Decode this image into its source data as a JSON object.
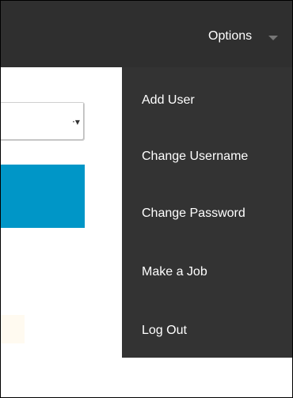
{
  "header": {
    "options_label": "Options",
    "options_caret_icon": "chevron-down-icon"
  },
  "form": {
    "select_arrow_icon": "chevron-down-icon"
  },
  "menu": {
    "items": [
      {
        "label": "Add User"
      },
      {
        "label": "Change Username"
      },
      {
        "label": "Change Password"
      },
      {
        "label": "Make a Job"
      },
      {
        "label": "Log Out"
      }
    ]
  },
  "colors": {
    "topbar": "#2f2f2f",
    "menu_bg": "#333333",
    "accent_blue": "#0096c7",
    "text_light": "#ffffff"
  }
}
